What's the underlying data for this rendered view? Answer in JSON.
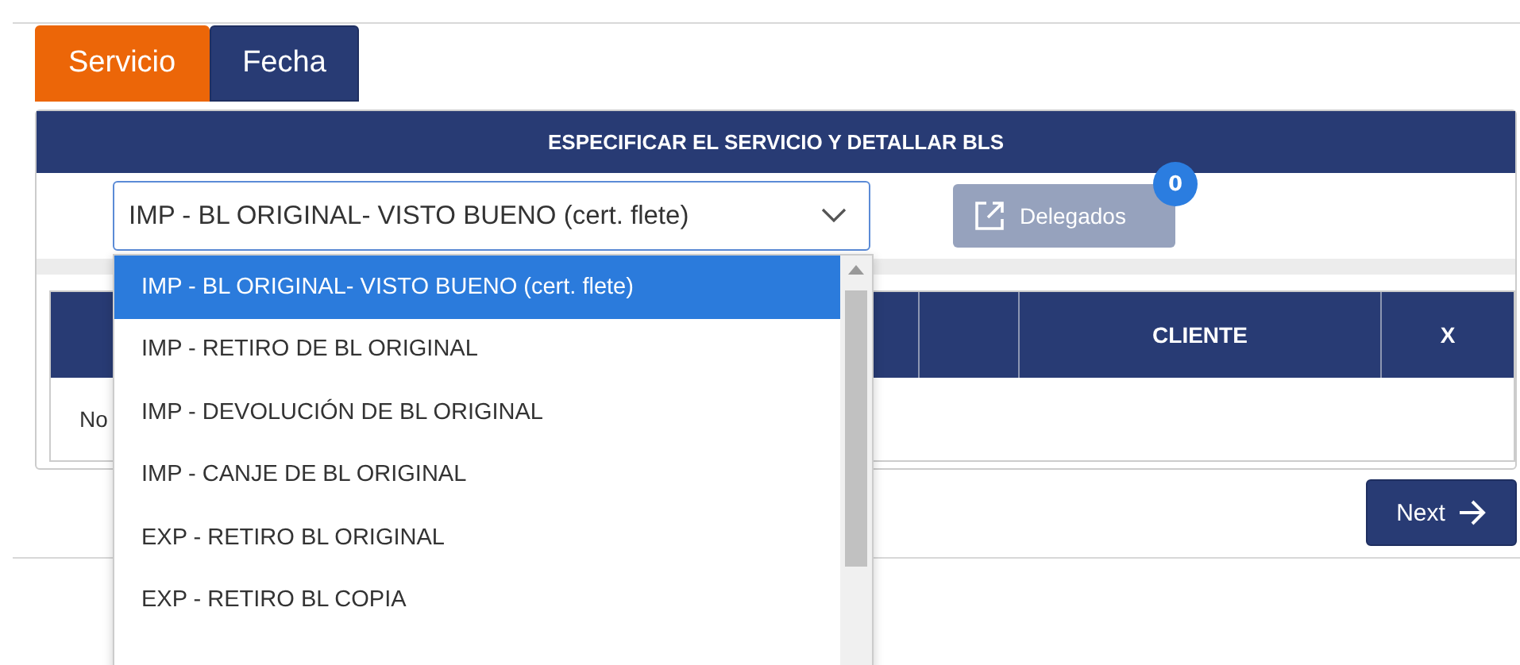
{
  "tabs": [
    {
      "label": "Servicio",
      "selected": true
    },
    {
      "label": "Fecha",
      "selected": false
    }
  ],
  "panel": {
    "title": "ESPECIFICAR EL SERVICIO Y DETALLAR BLS",
    "service_select": {
      "value": "IMP - BL ORIGINAL- VISTO BUENO (cert. flete)",
      "expanded": true,
      "options": [
        {
          "label": "IMP - BL ORIGINAL- VISTO BUENO (cert. flete)",
          "selected": true
        },
        {
          "label": "IMP - RETIRO DE BL ORIGINAL",
          "selected": false
        },
        {
          "label": "IMP - DEVOLUCIÓN DE BL ORIGINAL",
          "selected": false
        },
        {
          "label": "IMP - CANJE DE BL ORIGINAL",
          "selected": false
        },
        {
          "label": "EXP - RETIRO BL ORIGINAL",
          "selected": false
        },
        {
          "label": "EXP - RETIRO BL COPIA",
          "selected": false
        }
      ]
    },
    "delegados_button": {
      "label": "Delegados",
      "disabled": true,
      "badge": "0"
    },
    "table": {
      "columns": [
        "CLIENTE",
        "X"
      ],
      "empty_text": "No"
    }
  },
  "next_button": {
    "label": "Next"
  }
}
